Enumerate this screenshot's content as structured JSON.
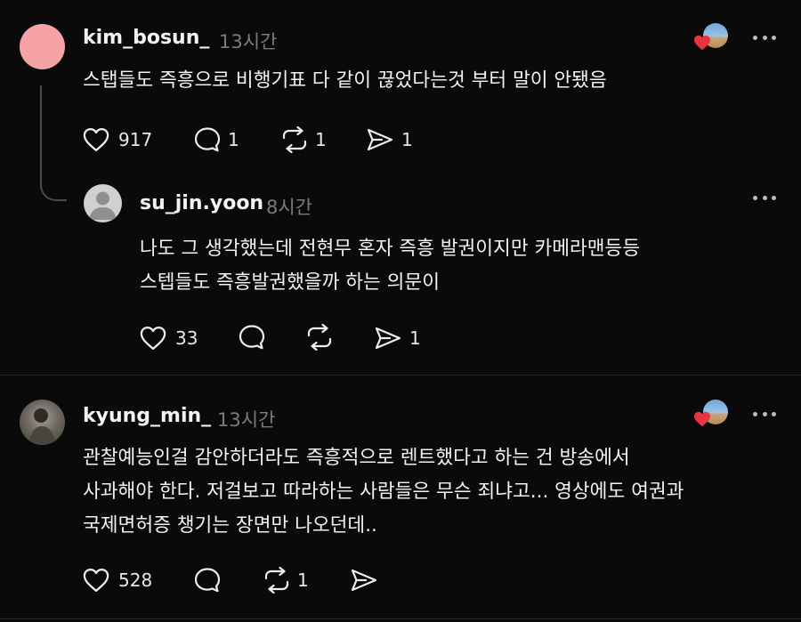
{
  "comments": [
    {
      "username": "kim_bosun_",
      "time": "13시간",
      "text_lines": [
        "스탭들도 즉흥으로 비행기표 다 같이 끊었다는것 부터 말이 안됐음"
      ],
      "likes": "917",
      "replies": "1",
      "reposts": "1",
      "shares": "1",
      "liked_by_author": true
    },
    {
      "username": "su_jin.yoon",
      "time": "8시간",
      "text_lines": [
        "나도 그 생각했는데 전현무 혼자 즉흥 발권이지만 카메라맨등등",
        "스텝들도 즉흥발권했을까 하는 의문이"
      ],
      "likes": "33",
      "shares": "1"
    },
    {
      "username": "kyung_min_",
      "time": "13시간",
      "text_lines": [
        "관찰예능인걸 감안하더라도 즉흥적으로 렌트했다고 하는 건 방송에서",
        "사과해야 한다. 저걸보고 따라하는 사람들은 무슨 죄냐고... 영상에도 여권과",
        "국제면허증 챙기는 장면만 나오던데.."
      ],
      "likes": "528",
      "reposts": "1",
      "liked_by_author": true
    }
  ],
  "colors": {
    "background": "#0a0a0a",
    "heart_badge": "#e8343f",
    "avatar_pink": "#f6a3a8",
    "muted_text": "#7b7b7b"
  },
  "icons": [
    "heart-icon",
    "comment-icon",
    "repost-icon",
    "share-icon",
    "more-icon"
  ]
}
